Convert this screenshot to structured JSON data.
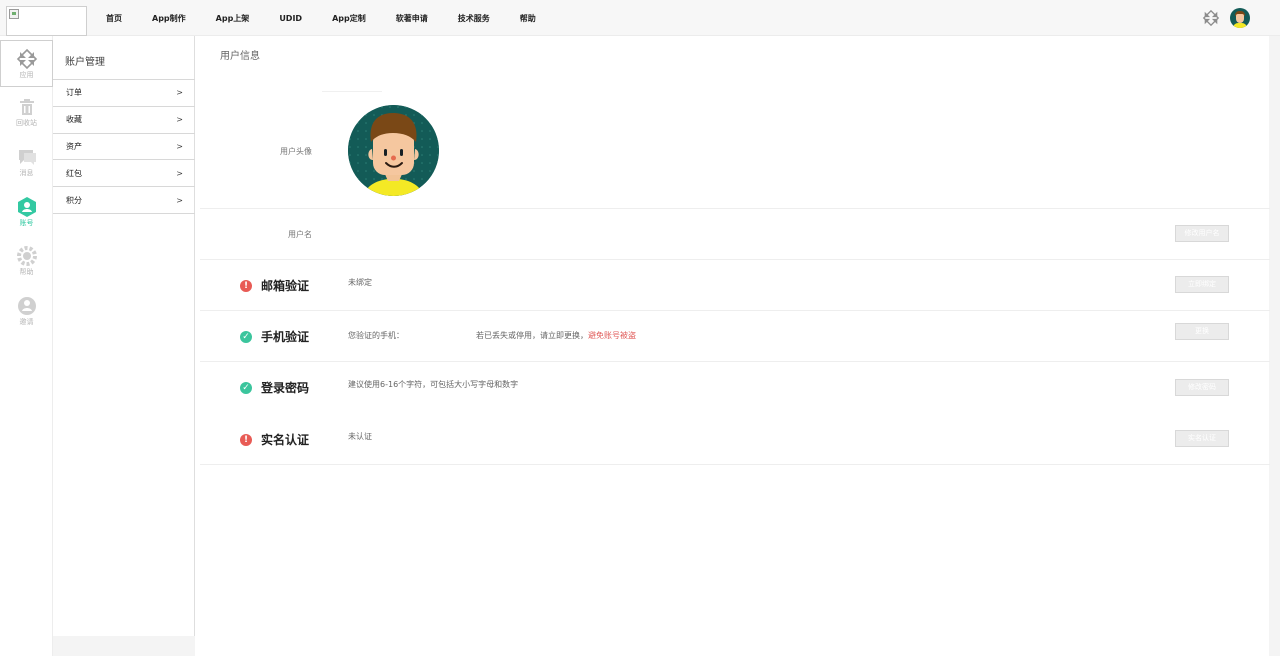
{
  "nav": {
    "items": [
      "首页",
      "App制作",
      "App上架",
      "UDID",
      "App定制",
      "软著申请",
      "技术服务",
      "帮助"
    ]
  },
  "left_rail": {
    "items": [
      {
        "label": "应用",
        "icon": "grid-icon",
        "active": false
      },
      {
        "label": "回收站",
        "icon": "trash-icon",
        "active": false
      },
      {
        "label": "消息",
        "icon": "message-icon",
        "active": false
      },
      {
        "label": "账号",
        "icon": "account-icon",
        "active": true
      },
      {
        "label": "帮助",
        "icon": "help-icon",
        "active": false
      },
      {
        "label": "邀请",
        "icon": "invite-icon",
        "active": false
      }
    ]
  },
  "menu": {
    "title": "账户管理",
    "items": [
      {
        "label": "订单",
        "arrow": ">"
      },
      {
        "label": "收藏",
        "arrow": ">"
      },
      {
        "label": "资产",
        "arrow": ">"
      },
      {
        "label": "红包",
        "arrow": ">"
      },
      {
        "label": "积分",
        "arrow": ">"
      }
    ]
  },
  "content": {
    "title": "用户信息",
    "avatar_label": "用户头像",
    "username_label": "用户名",
    "username_button": "修改用户名",
    "email": {
      "title": "邮箱验证",
      "desc": "未绑定",
      "button": "立即绑定"
    },
    "phone": {
      "title": "手机验证",
      "desc": "您验证的手机：",
      "extra": "若已丢失或停用，请立即更换，",
      "warning": "避免账号被盗",
      "button": "更换"
    },
    "password": {
      "title": "登录密码",
      "desc": "建议使用6-16个字符，可包括大小写字母和数字",
      "button": "修改密码"
    },
    "realname": {
      "title": "实名认证",
      "desc": "未认证",
      "button": "实名认证"
    }
  },
  "colors": {
    "accent": "#33c9a2",
    "warning": "#e05a58",
    "button": "#ececec"
  }
}
